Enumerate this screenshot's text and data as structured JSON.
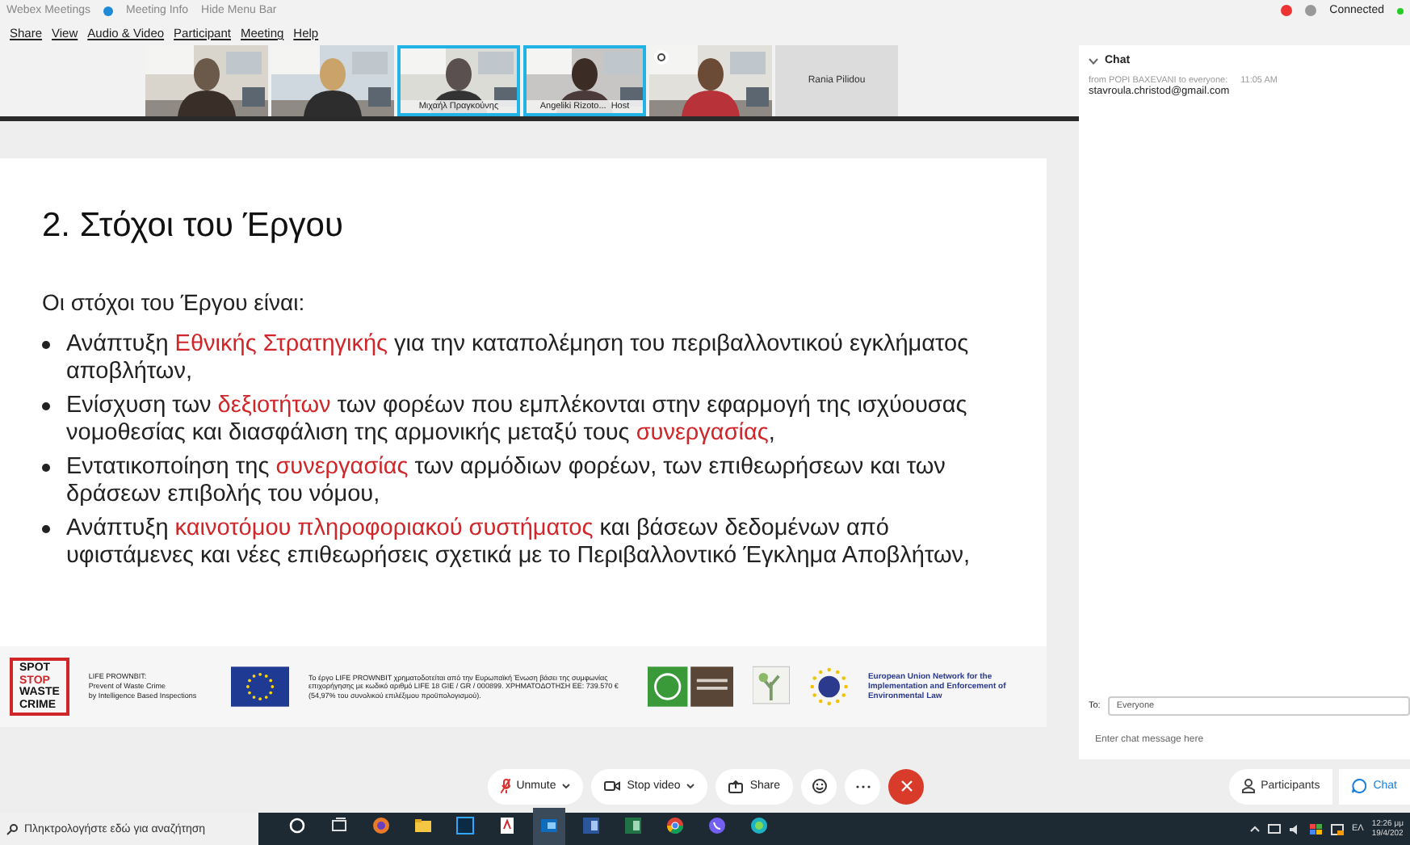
{
  "top_bar": {
    "app": "Webex Meetings",
    "meeting_info": "Meeting Info",
    "hide_menu": "Hide Menu Bar",
    "status": "Connected"
  },
  "menu": [
    "Share",
    "View",
    "Audio & Video",
    "Participant",
    "Meeting",
    "Help"
  ],
  "videos": [
    {
      "kind": "picture",
      "highlighted": false,
      "indicator": false
    },
    {
      "kind": "picture",
      "highlighted": false,
      "indicator": false
    },
    {
      "kind": "picture",
      "name": "Μιχαήλ Πραγκούνης",
      "highlighted": true,
      "indicator": false
    },
    {
      "kind": "picture",
      "name": "Angeliki Rizoto...",
      "role": "Host",
      "highlighted": true,
      "indicator": false
    },
    {
      "kind": "picture",
      "highlighted": false,
      "indicator": true
    },
    {
      "kind": "name_only",
      "name": "Rania Pilidou",
      "highlighted": false,
      "indicator": false
    }
  ],
  "slide": {
    "title": "2. Στόχοι του Έργου",
    "intro": "Οι στόχοι του Έργου είναι:",
    "bullets": [
      [
        {
          "text": "Ανάπτυξη ",
          "highlight": false
        },
        {
          "text": "Εθνικής Στρατηγικής",
          "highlight": true
        },
        {
          "text": " για την καταπολέμηση του περιβαλλοντικού εγκλήματος αποβλήτων,",
          "highlight": false
        }
      ],
      [
        {
          "text": "Ενίσχυση των ",
          "highlight": false
        },
        {
          "text": "δεξιοτήτων",
          "highlight": true
        },
        {
          "text": " των φορέων που εμπλέκονται στην εφαρμογή της ισχύουσας νομοθεσίας και διασφάλιση της αρμονικής μεταξύ τους ",
          "highlight": false
        },
        {
          "text": "συνεργασίας",
          "highlight": true
        },
        {
          "text": ",",
          "highlight": false
        }
      ],
      [
        {
          "text": "Εντατικοποίηση της ",
          "highlight": false
        },
        {
          "text": "συνεργασίας",
          "highlight": true
        },
        {
          "text": " των αρμόδιων φορέων, των επιθεωρήσεων και των δράσεων επιβολής του νόμου,",
          "highlight": false
        }
      ],
      [
        {
          "text": "Ανάπτυξη ",
          "highlight": false
        },
        {
          "text": "καινοτόμου πληροφοριακού συστήματος",
          "highlight": true
        },
        {
          "text": " και βάσεων δεδομένων από υφιστάμενες και νέες επιθεωρήσεις σχετικά με το Περιβαλλοντικό Έγκλημα Αποβλήτων,",
          "highlight": false
        }
      ]
    ],
    "footer": {
      "logo_lines": [
        "SPOT",
        "STOP",
        "WASTE",
        "CRIME"
      ],
      "project_lines": [
        "LIFE PROWNBIT:",
        "Prevent of Waste Crime",
        "by Intelligence Based Inspections"
      ],
      "funding": "Το έργο LIFE PROWNBIT χρηματοδοτείται από την Ευρωπαϊκή Ένωση βάσει της συμφωνίας επιχορήγησης με κωδικό αριθμό LIFE 18 GIE / GR / 000899. ΧΡΗΜΑΤΟΔΟΤΗΣΗ ΕΕ: 739.570 € (54,97% του συνολικού επιλέξιμου προϋπολογισμού).",
      "network": "European Union Network for the Implementation and Enforcement of Environmental Law"
    }
  },
  "chat": {
    "title": "Chat",
    "messages": [
      {
        "from": "from POPI BAXEVANI to everyone:",
        "time": "11:05 AM",
        "text": "stavroula.christod@gmail.com"
      }
    ],
    "to_label": "To:",
    "to_value": "Everyone",
    "placeholder": "Enter chat message here"
  },
  "controls": [
    {
      "kind": "mute",
      "label": "Unmute",
      "dropdown": true
    },
    {
      "kind": "video",
      "label": "Stop video",
      "dropdown": true
    },
    {
      "kind": "share",
      "label": "Share",
      "dropdown": false
    },
    {
      "kind": "reactions",
      "dropdown": false
    },
    {
      "kind": "more",
      "dropdown": false
    },
    {
      "kind": "leave",
      "dropdown": false
    }
  ],
  "panel_buttons": [
    {
      "kind": "participants",
      "label": "Participants",
      "selected": false
    },
    {
      "kind": "chat",
      "label": "Chat",
      "selected": true
    }
  ],
  "taskbar": {
    "search_placeholder": "Πληκτρολογήστε εδώ για αναζήτηση",
    "apps": [
      {
        "kind": "cortana"
      },
      {
        "kind": "taskview"
      },
      {
        "kind": "browser"
      },
      {
        "kind": "folder"
      },
      {
        "kind": "ps"
      },
      {
        "kind": "pdf"
      },
      {
        "kind": "outlook"
      },
      {
        "kind": "word"
      },
      {
        "kind": "excel"
      },
      {
        "kind": "chrome"
      },
      {
        "kind": "viber"
      },
      {
        "kind": "webex"
      }
    ],
    "language": "ΕΛ",
    "time": "12:26 μμ",
    "date": "19/4/202"
  }
}
